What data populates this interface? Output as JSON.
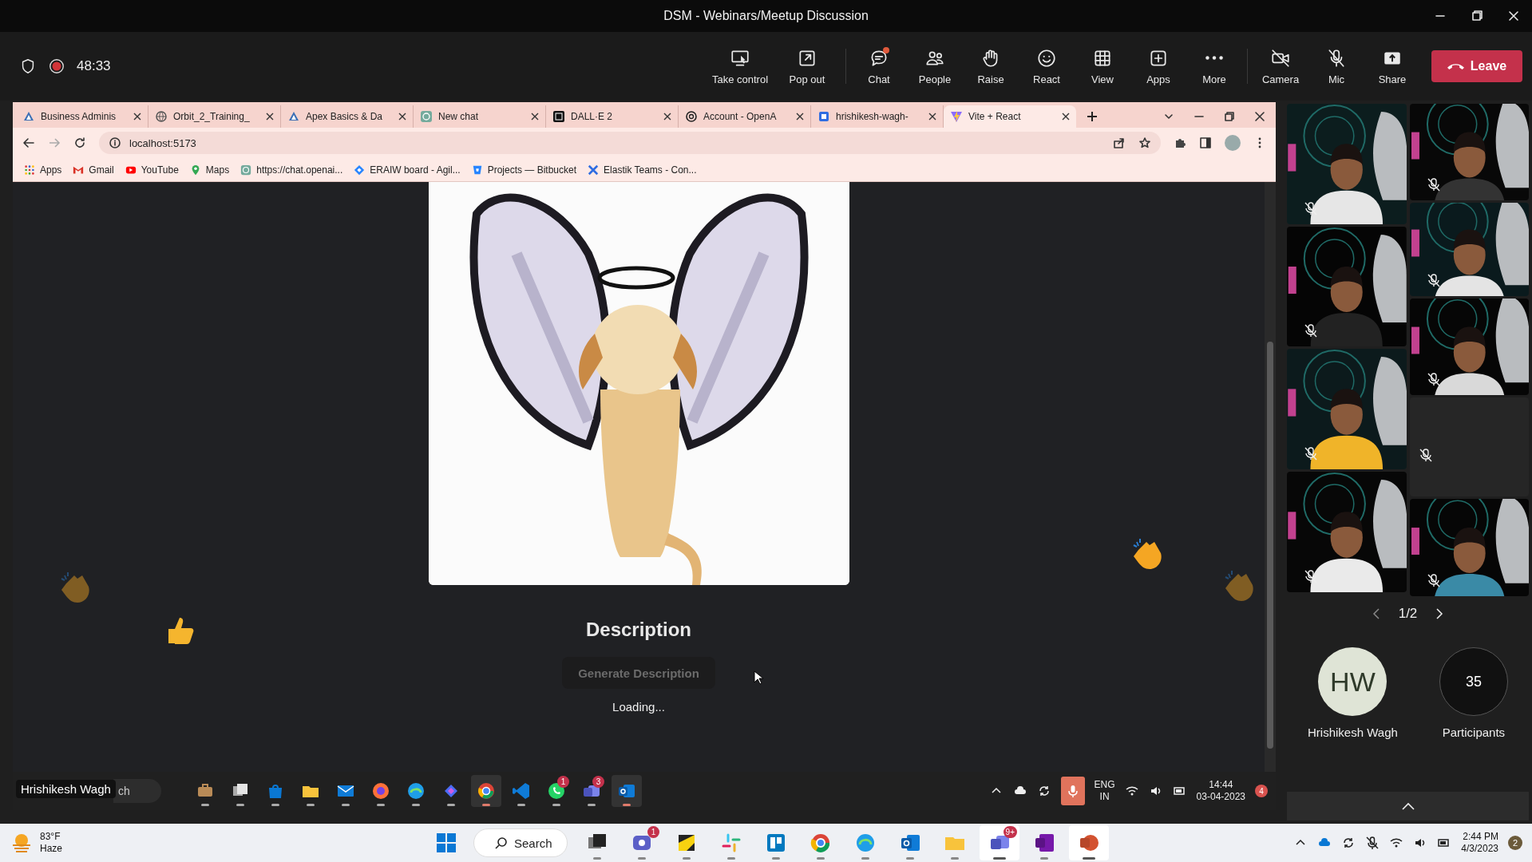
{
  "window": {
    "title": "DSM - Webinars/Meetup Discussion"
  },
  "meeting_bar": {
    "recording": true,
    "timer": "48:33",
    "tools": [
      {
        "label": "Take control"
      },
      {
        "label": "Pop out"
      }
    ],
    "actions": [
      {
        "label": "Chat",
        "notification": true
      },
      {
        "label": "People",
        "notification": false
      },
      {
        "label": "Raise",
        "notification": false
      },
      {
        "label": "React",
        "notification": false
      },
      {
        "label": "View",
        "notification": false
      },
      {
        "label": "Apps",
        "notification": false
      },
      {
        "label": "More",
        "notification": false
      }
    ],
    "devices": [
      {
        "label": "Camera",
        "on": false
      },
      {
        "label": "Mic",
        "on": false
      }
    ],
    "share": {
      "label": "Share"
    },
    "leave": {
      "label": "Leave"
    }
  },
  "shared_screen": {
    "presenter": "Hrishikesh Wagh",
    "browser": {
      "tabs": [
        {
          "title": "Business Adminis",
          "selected": false
        },
        {
          "title": "Orbit_2_Training_",
          "selected": false
        },
        {
          "title": "Apex Basics & Da",
          "selected": false
        },
        {
          "title": "New chat",
          "selected": false
        },
        {
          "title": "DALL·E 2",
          "selected": false
        },
        {
          "title": "Account - OpenA",
          "selected": false
        },
        {
          "title": "hrishikesh-wagh-",
          "selected": false
        },
        {
          "title": "Vite + React",
          "selected": true
        }
      ],
      "address": "localhost:5173",
      "bookmarks": [
        {
          "label": "Apps"
        },
        {
          "label": "Gmail"
        },
        {
          "label": "YouTube"
        },
        {
          "label": "Maps"
        },
        {
          "label": "https://chat.openai..."
        },
        {
          "label": "ERAIW board - Agil..."
        },
        {
          "label": "Projects — Bitbucket"
        },
        {
          "label": "Elastik Teams - Con..."
        }
      ]
    },
    "page": {
      "heading": "Description",
      "button": {
        "label": "Generate Description",
        "disabled": true
      },
      "status": "Loading..."
    },
    "reactions": [
      {
        "kind": "clap",
        "faded": true
      },
      {
        "kind": "thumbs",
        "faded": false
      },
      {
        "kind": "clap",
        "faded": false
      },
      {
        "kind": "clap",
        "faded": true
      }
    ],
    "remote_taskbar": {
      "search_text": "ch",
      "apps": [
        {
          "active": false
        },
        {
          "active": false
        },
        {
          "active": false
        },
        {
          "active": false
        },
        {
          "active": false
        },
        {
          "active": false
        },
        {
          "active": false
        },
        {
          "active": false
        },
        {
          "active": true
        },
        {
          "active": false
        },
        {
          "active": false,
          "badge": "1"
        },
        {
          "active": false,
          "badge": "3"
        },
        {
          "active": true
        }
      ],
      "language": "ENG",
      "region": "IN",
      "time": "14:44",
      "date": "03-04-2023",
      "notifications": "4"
    }
  },
  "participants_panel": {
    "tiles": [
      {
        "video": true,
        "muted": true
      },
      {
        "video": true,
        "muted": true
      },
      {
        "video": true,
        "muted": true
      },
      {
        "video": true,
        "muted": true
      },
      {
        "video": true,
        "muted": true
      },
      {
        "video": true,
        "muted": true
      },
      {
        "video": true,
        "muted": true
      },
      {
        "video": false,
        "muted": true
      },
      {
        "video": true,
        "muted": true
      }
    ],
    "pager": "1/2",
    "self": {
      "initials": "HW",
      "name": "Hrishikesh Wagh"
    },
    "participants": {
      "count": "35",
      "label": "Participants"
    }
  },
  "taskbar": {
    "weather": {
      "temperature": "83°F",
      "condition": "Haze"
    },
    "search": "Search",
    "apps": [
      {
        "active": false
      },
      {
        "active": false,
        "badge": "1"
      },
      {
        "active": false
      },
      {
        "active": false
      },
      {
        "active": false
      },
      {
        "active": false
      },
      {
        "active": false
      },
      {
        "active": false
      },
      {
        "active": false
      },
      {
        "active": true,
        "badge": "9+"
      },
      {
        "active": false
      },
      {
        "active": true
      }
    ],
    "time": "2:44 PM",
    "date": "4/3/2023",
    "notifications": "2"
  }
}
